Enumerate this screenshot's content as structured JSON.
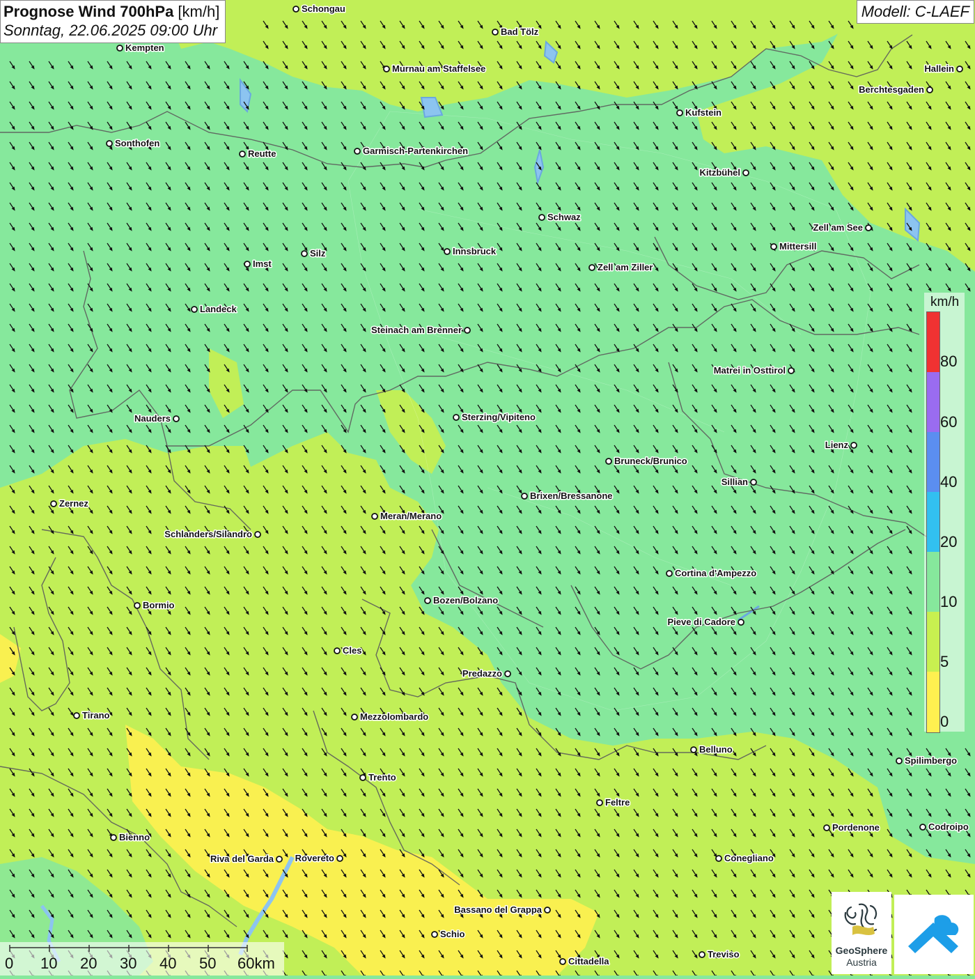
{
  "title": {
    "bold": "Prognose Wind 700hPa",
    "unit": " [km/h]",
    "datetime": "Sonntag, 22.06.2025 09:00 Uhr"
  },
  "model_label": "Modell: C-LAEF",
  "legend": {
    "unit": "km/h",
    "labels": [
      "80",
      "60",
      "40",
      "20",
      "10",
      "5",
      "0"
    ],
    "colors": [
      "#f03232",
      "#9a6cf0",
      "#5b8ef0",
      "#32c0f0",
      "#86e89c",
      "#c8f050",
      "#fff050"
    ]
  },
  "scale": {
    "labels": [
      "0",
      "10",
      "20",
      "30",
      "40",
      "50",
      "60km"
    ]
  },
  "logos": {
    "geosphere_name": "GeoSphere",
    "geosphere_sub": "Austria",
    "geosphere_icon": "geosphere-logo-icon",
    "app_icon": "warn-app-logo-icon"
  },
  "map": {
    "wind_direction": "from north-west",
    "colors": {
      "base": "#86e89c",
      "light": "#c8f050",
      "calm": "#fff050",
      "river": "#6aa8e0",
      "border": "#5c5c5c"
    },
    "cities": [
      {
        "name": "Schongau"
      },
      {
        "name": "Bad Tölz"
      },
      {
        "name": "Kempten"
      },
      {
        "name": "Murnau am Staffelsee"
      },
      {
        "name": "Hallein"
      },
      {
        "name": "Berchtesgaden"
      },
      {
        "name": "Kufstein"
      },
      {
        "name": "Sonthofen"
      },
      {
        "name": "Reutte"
      },
      {
        "name": "Garmisch-Partenkirchen"
      },
      {
        "name": "Kitzbühel"
      },
      {
        "name": "Schwaz"
      },
      {
        "name": "Zell am See"
      },
      {
        "name": "Mittersill"
      },
      {
        "name": "Innsbruck"
      },
      {
        "name": "Silz"
      },
      {
        "name": "Imst"
      },
      {
        "name": "Zell am Ziller"
      },
      {
        "name": "Landeck"
      },
      {
        "name": "Steinach am Brenner"
      },
      {
        "name": "Matrei in Osttirol"
      },
      {
        "name": "Nauders"
      },
      {
        "name": "Sterzing/Vipiteno"
      },
      {
        "name": "Lienz"
      },
      {
        "name": "Bruneck/Brunico"
      },
      {
        "name": "Sillian"
      },
      {
        "name": "Zernez"
      },
      {
        "name": "Brixen/Bressanone"
      },
      {
        "name": "Meran/Merano"
      },
      {
        "name": "Schlanders/Silandro"
      },
      {
        "name": "Cortina d'Ampezzo"
      },
      {
        "name": "Bozen/Bolzano"
      },
      {
        "name": "Bormio"
      },
      {
        "name": "Pieve di Cadore"
      },
      {
        "name": "Cles"
      },
      {
        "name": "Predazzo"
      },
      {
        "name": "Tirano"
      },
      {
        "name": "Mezzolombardo"
      },
      {
        "name": "Belluno"
      },
      {
        "name": "Spilimbergo"
      },
      {
        "name": "Trento"
      },
      {
        "name": "Feltre"
      },
      {
        "name": "Pordenone"
      },
      {
        "name": "Codroipo"
      },
      {
        "name": "Bienno"
      },
      {
        "name": "Riva del Garda"
      },
      {
        "name": "Rovereto"
      },
      {
        "name": "Conegliano"
      },
      {
        "name": "Bassano del Grappa"
      },
      {
        "name": "Schio"
      },
      {
        "name": "Treviso"
      },
      {
        "name": "Cittadella"
      }
    ]
  }
}
